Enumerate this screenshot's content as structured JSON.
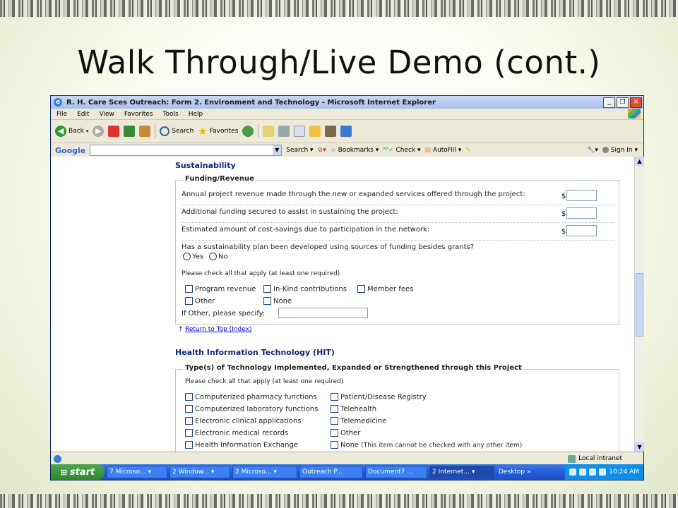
{
  "slide": {
    "title": "Walk Through/Live Demo (cont.)"
  },
  "window": {
    "title": "R. H. Care Sces Outreach: Form 2. Environment and Technology - Microsoft Internet Explorer",
    "menu": [
      "File",
      "Edit",
      "View",
      "Favorites",
      "Tools",
      "Help"
    ],
    "toolbar": {
      "back": "Back",
      "search": "Search",
      "favorites": "Favorites"
    },
    "google_bar": {
      "logo": "Google",
      "search": "Search",
      "bookmarks": "Bookmarks",
      "check": "Check",
      "autofill": "AutoFill",
      "signin": "Sign In"
    },
    "status": {
      "zone": "Local intranet"
    }
  },
  "form": {
    "sustainability": {
      "title": "Sustainability",
      "legend": "Funding/Revenue",
      "q1": "Annual project revenue made through the new or expanded services offered through the project:",
      "q2": "Additional funding secured to assist in sustaining the project:",
      "q3": "Estimated amount of cost-savings due to participation in the network:",
      "dollar": "$",
      "q4": "Has a sustainability plan been developed using sources of funding besides grants?",
      "yes": "Yes",
      "no": "No",
      "check_note": "Please check all that apply (at least one required)",
      "options": [
        "Program revenue",
        "In-Kind contributions",
        "Member fees",
        "Other",
        "None"
      ],
      "other_label": "If Other, please specify:",
      "return_arrow": "↑",
      "return_link": "Return to Top (Index)"
    },
    "hit": {
      "title": "Health Information Technology (HIT)",
      "legend": "Type(s) of Technology Implemented, Expanded or Strengthened through this Project",
      "check_note": "Please check all that apply (at least one required)",
      "left_options": [
        "Computerized pharmacy functions",
        "Computerized laboratory functions",
        "Electronic clinical applications",
        "Electronic medical records",
        "Health Information Exchange"
      ],
      "right_options": [
        "Patient/Disease Registry",
        "Telehealth",
        "Telemedicine",
        "Other",
        "None"
      ],
      "none_note": "(This item cannot be checked with any other item)"
    }
  },
  "taskbar": {
    "start": "start",
    "tasks": [
      "7 Microso...",
      "2 Window...",
      "2 Microso...",
      "Outreach P...",
      "Document7 ...",
      "2 Internet...",
      "Desktop"
    ],
    "clock": "10:24 AM"
  }
}
